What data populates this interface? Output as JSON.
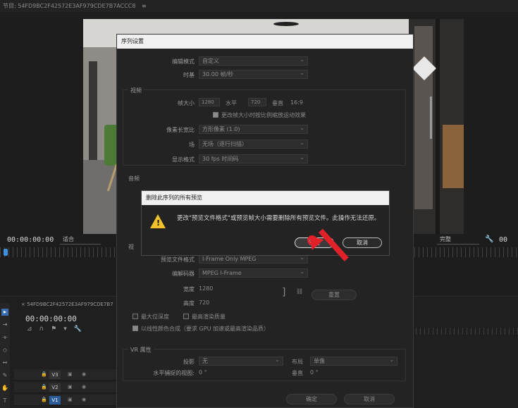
{
  "program_tab": {
    "label": "节目: 54FD9BC2F42572E3AF979CDE7B7ACCC8",
    "menu": "≡"
  },
  "monitor": {
    "timecode_left": "00:00:00:00",
    "fit_select": "适合",
    "quality_select": "完整",
    "timecode_right": "00"
  },
  "timeline": {
    "sequence_tab": "54FD9BC2F42572E3AF979CDE7B7",
    "timecode": "00:00:00:00",
    "tracks": [
      {
        "label": "V3",
        "selected": false
      },
      {
        "label": "V2",
        "selected": false
      },
      {
        "label": "V1",
        "selected": true
      }
    ]
  },
  "sequence_settings": {
    "title": "序列设置",
    "edit_mode_label": "编辑模式",
    "edit_mode_value": "自定义",
    "timebase_label": "时基",
    "timebase_value": "30.00 帧/秒",
    "video_group": "视频",
    "frame_size_label": "帧大小",
    "frame_width": "1280",
    "horizontal_label": "水平",
    "frame_height": "720",
    "vertical_label": "垂直",
    "aspect": "16:9",
    "scale_motion_check": "更改帧大小时按比例缩放运动效果",
    "pixel_aspect_label": "像素长宽比",
    "pixel_aspect_value": "方形像素 (1.0)",
    "field_label": "场",
    "field_value": "无场（逐行扫描）",
    "display_format_label": "显示格式",
    "display_format_value": "30 fps 时间码",
    "audio_group": "音频",
    "preview_group": "视",
    "preview_format_label": "预览文件格式",
    "preview_format_value": "I-Frame Only MPEG",
    "codec_label": "编解码器",
    "codec_value": "MPEG I-Frame",
    "width_label": "宽度",
    "width_value": "1280",
    "height_label": "高度",
    "height_value": "720",
    "reset_button": "重置",
    "max_bit_depth": "最大位深度",
    "max_render_quality": "最高渲染质量",
    "linear_color": "以线性颜色合成（要求 GPU 加速或最高渲染品质）",
    "vr_group": "VR 属性",
    "projection_label": "投影",
    "projection_value": "无",
    "layout_label": "布局",
    "layout_value": "单像",
    "h_fov_label": "水平捕捉的视图:",
    "h_fov_value": "0 °",
    "v_fov_label": "垂直",
    "v_fov_value": "0 °",
    "ok_button": "确定",
    "cancel_button": "取消"
  },
  "alert": {
    "title": "删除此序列的所有预览",
    "message": "更改\"预览文件格式\"或预览帧大小需要删除所有预览文件。此操作无法还原。",
    "ok_button": "确定",
    "cancel_button": "取消"
  },
  "colors": {
    "warning": "#f2c22b",
    "annotation": "#e0212a",
    "accent": "#2b5e9a"
  }
}
